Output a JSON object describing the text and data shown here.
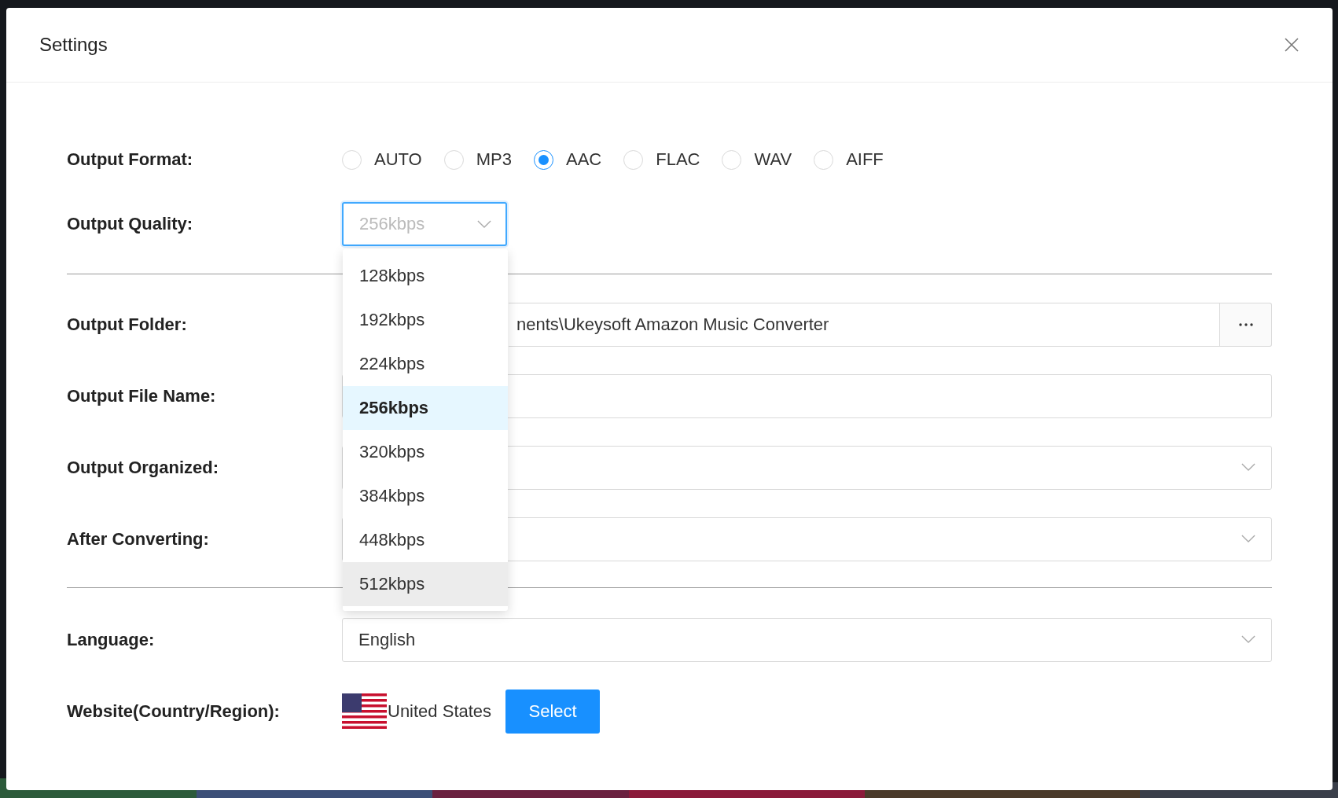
{
  "window": {
    "title": "Settings"
  },
  "output_format": {
    "label": "Output Format:",
    "options": [
      {
        "label": "AUTO",
        "selected": false
      },
      {
        "label": "MP3",
        "selected": false
      },
      {
        "label": "AAC",
        "selected": true
      },
      {
        "label": "FLAC",
        "selected": false
      },
      {
        "label": "WAV",
        "selected": false
      },
      {
        "label": "AIFF",
        "selected": false
      }
    ]
  },
  "output_quality": {
    "label": "Output Quality:",
    "value": "256kbps",
    "expanded": true,
    "options": [
      {
        "label": "128kbps",
        "selected": false,
        "hovered": false
      },
      {
        "label": "192kbps",
        "selected": false,
        "hovered": false
      },
      {
        "label": "224kbps",
        "selected": false,
        "hovered": false
      },
      {
        "label": "256kbps",
        "selected": true,
        "hovered": false
      },
      {
        "label": "320kbps",
        "selected": false,
        "hovered": false
      },
      {
        "label": "384kbps",
        "selected": false,
        "hovered": false
      },
      {
        "label": "448kbps",
        "selected": false,
        "hovered": false
      },
      {
        "label": "512kbps",
        "selected": false,
        "hovered": true
      }
    ]
  },
  "fields": [
    {
      "kind": "folder",
      "label": "Output Folder:",
      "value": "nents\\Ukeysoft Amazon Music Converter"
    },
    {
      "kind": "text",
      "label": "Output File Name:"
    },
    {
      "kind": "select",
      "label": "Output Organized:"
    },
    {
      "kind": "select",
      "label": "After Converting:"
    }
  ],
  "language": {
    "label": "Language:",
    "value": "English"
  },
  "website": {
    "label": "Website(Country/Region):",
    "country": "United States",
    "button": "Select"
  }
}
